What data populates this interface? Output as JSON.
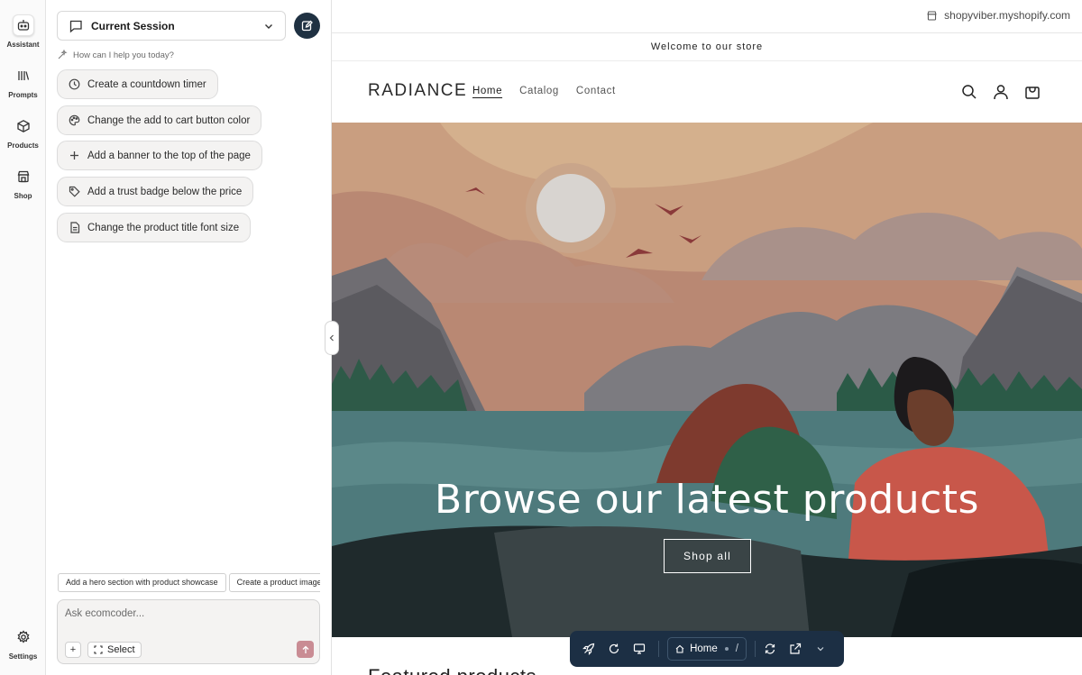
{
  "rail": {
    "items": [
      {
        "label": "Assistant",
        "icon": "robot-icon",
        "active": true
      },
      {
        "label": "Prompts",
        "icon": "library-icon",
        "active": false
      },
      {
        "label": "Products",
        "icon": "box-icon",
        "active": false
      },
      {
        "label": "Shop",
        "icon": "storefront-icon",
        "active": false
      }
    ],
    "settings": {
      "label": "Settings",
      "icon": "gear-icon"
    }
  },
  "panel": {
    "session_label": "Current Session",
    "helper_text": "How can I help you today?",
    "suggestions": [
      {
        "label": "Create a countdown timer",
        "icon": "clock-icon"
      },
      {
        "label": "Change the add to cart button color",
        "icon": "palette-icon"
      },
      {
        "label": "Add a banner to the top of the page",
        "icon": "plus-icon"
      },
      {
        "label": "Add a trust badge below the price",
        "icon": "tag-icon"
      },
      {
        "label": "Change the product title font size",
        "icon": "document-icon"
      }
    ],
    "chips": [
      "Add a hero section with product showcase",
      "Create a product image gallery"
    ],
    "composer": {
      "placeholder": "Ask ecomcoder...",
      "plus_label": "+",
      "select_label": "Select"
    }
  },
  "preview": {
    "url": "shopyviber.myshopify.com",
    "announcement": "Welcome to our store",
    "logo": "RADIANCE",
    "nav": [
      "Home",
      "Catalog",
      "Contact"
    ],
    "hero_title": "Browse our latest products",
    "hero_button": "Shop all",
    "below_heading": "Featured products"
  },
  "toolbar": {
    "route_label": "Home",
    "route_path": "/"
  },
  "colors": {
    "accent": "#1f3142",
    "toolbar_bg": "#1c2f44",
    "send_button": "#c98c94"
  }
}
